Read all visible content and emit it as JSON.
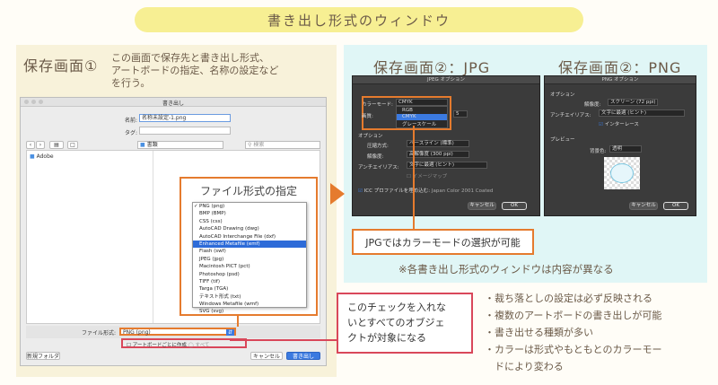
{
  "banner": {
    "title": "書き出し形式のウィンドウ"
  },
  "left": {
    "heading": "保存画面①",
    "note": [
      "この画面で保存先と書き出し形式、",
      "アートボードの指定、名称の設定など",
      "を行う。"
    ]
  },
  "save_dialog": {
    "title": "書き出し",
    "name_label": "名前:",
    "name_value": "名称未設定-1.png",
    "tag_label": "タグ:",
    "location": "書類",
    "search_placeholder": "検索",
    "sidebar_item": "Adobe",
    "format_label": "ファイル形式:",
    "format_value": "PNG (png)",
    "artboard_check": "アートボードごとに作成",
    "range_all": "すべて",
    "range_label": "範囲:",
    "new_folder": "新規フォルダ",
    "cancel": "キャンセル",
    "export": "書き出し"
  },
  "fileformat_callout": {
    "title": "ファイル形式の指定",
    "options": [
      "PNG (png)",
      "BMP (BMP)",
      "CSS (css)",
      "AutoCAD Drawing (dwg)",
      "AutoCAD Interchange File (dxf)",
      "Enhanced Metafile (emf)",
      "Flash (swf)",
      "JPEG (jpg)",
      "Macintosh PICT (pct)",
      "Photoshop (psd)",
      "TIFF (tif)",
      "Targa (TGA)",
      "テキスト形式 (txt)",
      "Windows Metafile (wmf)",
      "SVG (svg)"
    ],
    "selected_index": 5
  },
  "check_callout": {
    "lines": [
      "このチェックを入れな",
      "いとすべてのオブジェ",
      "クトが対象になる"
    ]
  },
  "jpg": {
    "heading": "保存画面②：JPG",
    "title": "JPEG オプション",
    "color_model_label": "カラーモード:",
    "color_model_value": "CMYK",
    "quality_label": "画質:",
    "quality_value": "5",
    "options_label": "オプション",
    "compress_label": "圧縮方式:",
    "compress_value": "ベースライン (標準)",
    "resolution_label": "解像度:",
    "resolution_value": "高解像度 (300 ppi)",
    "antialias_label": "アンチエイリアス:",
    "antialias_value": "文字に最適 (ヒント)",
    "imagemap_label": "イメージマップ",
    "icc_label": "ICC プロファイルを埋め込む:",
    "icc_value": "Japan Color 2001 Coated",
    "cancel": "キャンセル",
    "ok": "OK",
    "mode_options": [
      "RGB",
      "CMYK",
      "グレースケール"
    ]
  },
  "png": {
    "heading": "保存画面②：PNG",
    "title": "PNG オプション",
    "options_label": "オプション",
    "resolution_label": "解像度:",
    "resolution_value": "スクリーン (72 ppi)",
    "antialias_label": "アンチエイリアス:",
    "antialias_value": "文字に最適 (ヒント)",
    "interlace_label": "インターレース",
    "preview_label": "プレビュー",
    "bg_label": "背景色:",
    "bg_value": "透明",
    "cancel": "キャンセル",
    "ok": "OK"
  },
  "jpgmode_callout": {
    "text": "JPGではカラーモードの選択が可能"
  },
  "caution": {
    "text": "※各書き出し形式のウィンドウは内容が異なる"
  },
  "bullets": [
    "・裁ち落としの設定は必ず反映される",
    "・複数のアートボードの書き出しが可能",
    "・書き出せる種類が多い",
    "・カラーは形式やもともとのカラーモー",
    "　ドにより変わる"
  ],
  "colors": {
    "accent": "#e57b2e",
    "red": "#d9475a",
    "banner": "#f7ef93"
  }
}
